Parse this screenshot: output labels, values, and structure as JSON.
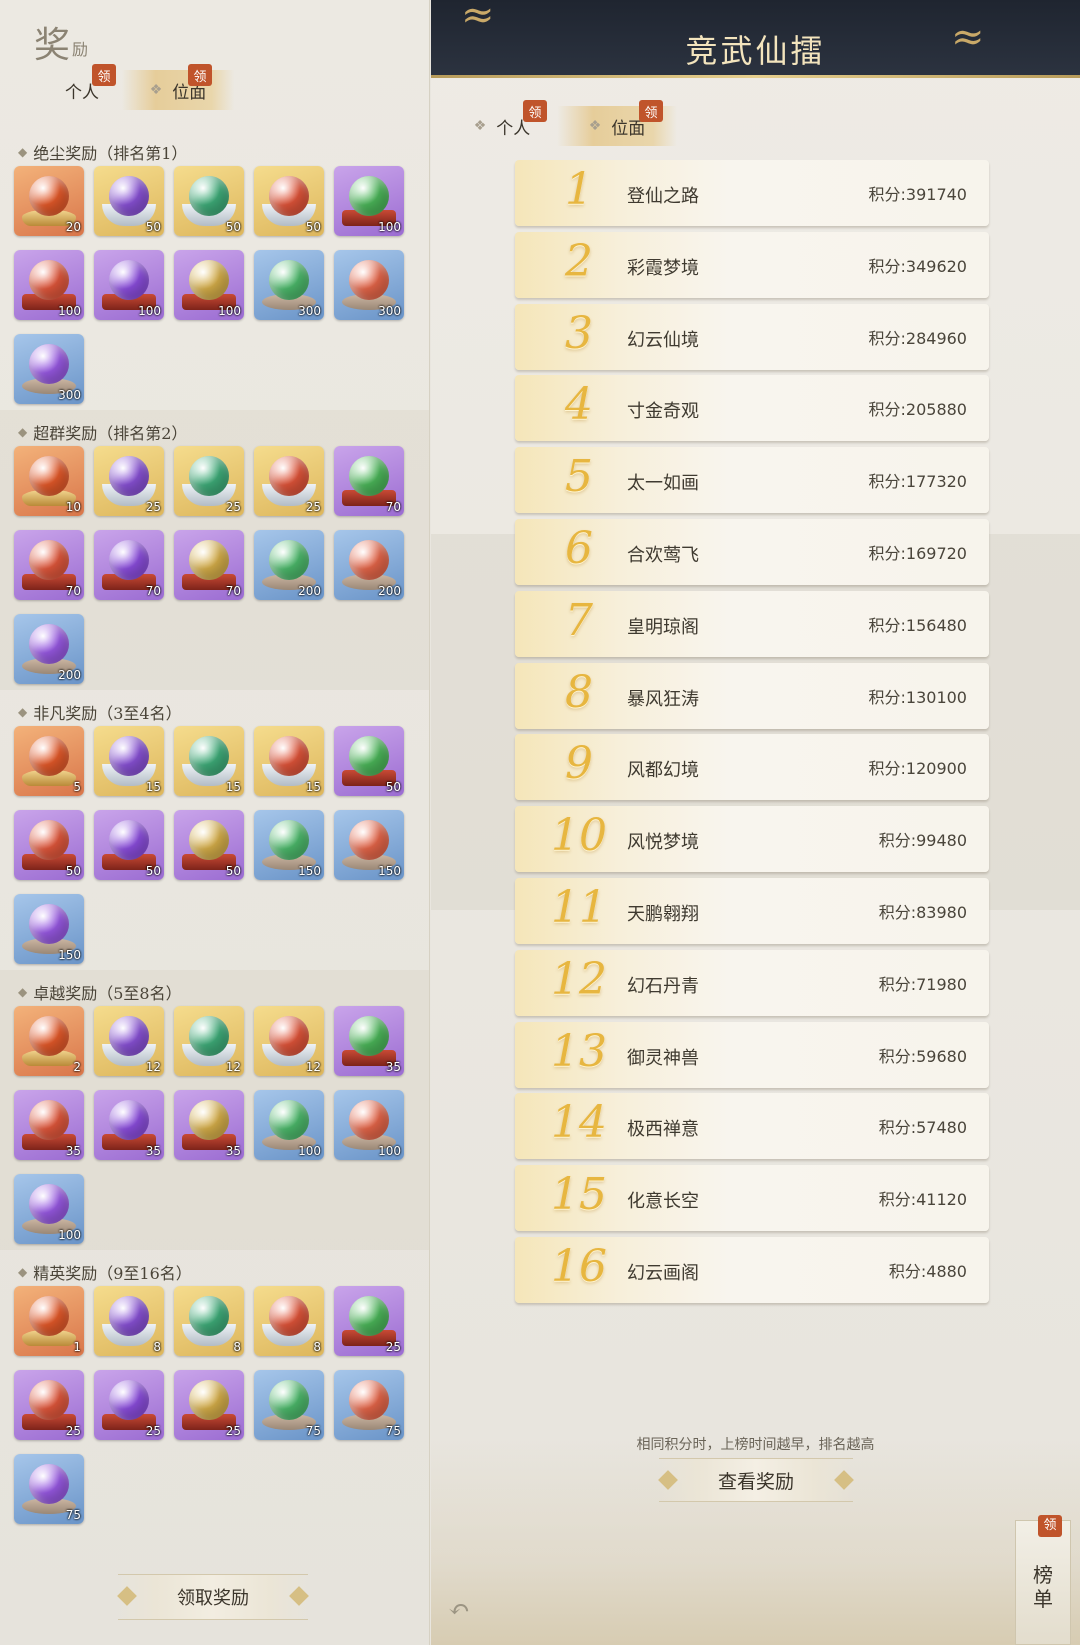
{
  "left_panel": {
    "title": "奖",
    "title_sub": "励",
    "tabs": [
      {
        "label": "个人",
        "badge": "领",
        "active": false
      },
      {
        "label": "位面",
        "badge": "领",
        "active": true
      }
    ],
    "sections": [
      {
        "title": "绝尘奖励（排名第1）",
        "items": [
          {
            "icon": "phoenix-orb-icon",
            "bg": "orange",
            "orb": "#e65a2a",
            "base": "lotus",
            "qty": "20"
          },
          {
            "icon": "purple-pill-bowl-icon",
            "bg": "gold",
            "orb": "#8a52d8",
            "base": "bowl",
            "qty": "50"
          },
          {
            "icon": "green-pill-bowl-icon",
            "bg": "gold",
            "orb": "#3fae7a",
            "base": "bowl",
            "qty": "50"
          },
          {
            "icon": "red-pill-bowl-icon",
            "bg": "gold",
            "orb": "#e2553a",
            "base": "bowl",
            "qty": "50"
          },
          {
            "icon": "green-orb-pedestal-icon",
            "bg": "purple",
            "orb": "#4cb85a",
            "base": "red",
            "qty": "100"
          },
          {
            "icon": "red-orb-pedestal-icon",
            "bg": "purple",
            "orb": "#e3583c",
            "base": "red",
            "qty": "100"
          },
          {
            "icon": "purple-orb-pedestal-icon",
            "bg": "purple",
            "orb": "#8d4ee0",
            "base": "red",
            "qty": "100"
          },
          {
            "icon": "gold-orb-pedestal-icon",
            "bg": "purple",
            "orb": "#d8b04a",
            "base": "red",
            "qty": "100"
          },
          {
            "icon": "green-orb-stone-icon",
            "bg": "blue",
            "orb": "#4dbb6c",
            "base": "stone",
            "qty": "300"
          },
          {
            "icon": "red-orb-stone-icon",
            "bg": "blue",
            "orb": "#e8674a",
            "base": "stone",
            "qty": "300"
          },
          {
            "icon": "purple-orb-stone-icon",
            "bg": "blue",
            "orb": "#9a5ae6",
            "base": "stone",
            "qty": "300"
          }
        ]
      },
      {
        "title": "超群奖励（排名第2）",
        "items": [
          {
            "icon": "phoenix-orb-icon",
            "bg": "orange",
            "orb": "#e65a2a",
            "base": "lotus",
            "qty": "10"
          },
          {
            "icon": "purple-pill-bowl-icon",
            "bg": "gold",
            "orb": "#8a52d8",
            "base": "bowl",
            "qty": "25"
          },
          {
            "icon": "green-pill-bowl-icon",
            "bg": "gold",
            "orb": "#3fae7a",
            "base": "bowl",
            "qty": "25"
          },
          {
            "icon": "red-pill-bowl-icon",
            "bg": "gold",
            "orb": "#e2553a",
            "base": "bowl",
            "qty": "25"
          },
          {
            "icon": "green-orb-pedestal-icon",
            "bg": "purple",
            "orb": "#4cb85a",
            "base": "red",
            "qty": "70"
          },
          {
            "icon": "red-orb-pedestal-icon",
            "bg": "purple",
            "orb": "#e3583c",
            "base": "red",
            "qty": "70"
          },
          {
            "icon": "purple-orb-pedestal-icon",
            "bg": "purple",
            "orb": "#8d4ee0",
            "base": "red",
            "qty": "70"
          },
          {
            "icon": "gold-orb-pedestal-icon",
            "bg": "purple",
            "orb": "#d8b04a",
            "base": "red",
            "qty": "70"
          },
          {
            "icon": "green-orb-stone-icon",
            "bg": "blue",
            "orb": "#4dbb6c",
            "base": "stone",
            "qty": "200"
          },
          {
            "icon": "red-orb-stone-icon",
            "bg": "blue",
            "orb": "#e8674a",
            "base": "stone",
            "qty": "200"
          },
          {
            "icon": "purple-orb-stone-icon",
            "bg": "blue",
            "orb": "#9a5ae6",
            "base": "stone",
            "qty": "200"
          }
        ]
      },
      {
        "title": "非凡奖励（3至4名）",
        "items": [
          {
            "icon": "phoenix-orb-icon",
            "bg": "orange",
            "orb": "#e65a2a",
            "base": "lotus",
            "qty": "5"
          },
          {
            "icon": "purple-pill-bowl-icon",
            "bg": "gold",
            "orb": "#8a52d8",
            "base": "bowl",
            "qty": "15"
          },
          {
            "icon": "green-pill-bowl-icon",
            "bg": "gold",
            "orb": "#3fae7a",
            "base": "bowl",
            "qty": "15"
          },
          {
            "icon": "red-pill-bowl-icon",
            "bg": "gold",
            "orb": "#e2553a",
            "base": "bowl",
            "qty": "15"
          },
          {
            "icon": "green-orb-pedestal-icon",
            "bg": "purple",
            "orb": "#4cb85a",
            "base": "red",
            "qty": "50"
          },
          {
            "icon": "red-orb-pedestal-icon",
            "bg": "purple",
            "orb": "#e3583c",
            "base": "red",
            "qty": "50"
          },
          {
            "icon": "purple-orb-pedestal-icon",
            "bg": "purple",
            "orb": "#8d4ee0",
            "base": "red",
            "qty": "50"
          },
          {
            "icon": "gold-orb-pedestal-icon",
            "bg": "purple",
            "orb": "#d8b04a",
            "base": "red",
            "qty": "50"
          },
          {
            "icon": "green-orb-stone-icon",
            "bg": "blue",
            "orb": "#4dbb6c",
            "base": "stone",
            "qty": "150"
          },
          {
            "icon": "red-orb-stone-icon",
            "bg": "blue",
            "orb": "#e8674a",
            "base": "stone",
            "qty": "150"
          },
          {
            "icon": "purple-orb-stone-icon",
            "bg": "blue",
            "orb": "#9a5ae6",
            "base": "stone",
            "qty": "150"
          }
        ]
      },
      {
        "title": "卓越奖励（5至8名）",
        "items": [
          {
            "icon": "phoenix-orb-icon",
            "bg": "orange",
            "orb": "#e65a2a",
            "base": "lotus",
            "qty": "2"
          },
          {
            "icon": "purple-pill-bowl-icon",
            "bg": "gold",
            "orb": "#8a52d8",
            "base": "bowl",
            "qty": "12"
          },
          {
            "icon": "green-pill-bowl-icon",
            "bg": "gold",
            "orb": "#3fae7a",
            "base": "bowl",
            "qty": "12"
          },
          {
            "icon": "red-pill-bowl-icon",
            "bg": "gold",
            "orb": "#e2553a",
            "base": "bowl",
            "qty": "12"
          },
          {
            "icon": "green-orb-pedestal-icon",
            "bg": "purple",
            "orb": "#4cb85a",
            "base": "red",
            "qty": "35"
          },
          {
            "icon": "red-orb-pedestal-icon",
            "bg": "purple",
            "orb": "#e3583c",
            "base": "red",
            "qty": "35"
          },
          {
            "icon": "purple-orb-pedestal-icon",
            "bg": "purple",
            "orb": "#8d4ee0",
            "base": "red",
            "qty": "35"
          },
          {
            "icon": "gold-orb-pedestal-icon",
            "bg": "purple",
            "orb": "#d8b04a",
            "base": "red",
            "qty": "35"
          },
          {
            "icon": "green-orb-stone-icon",
            "bg": "blue",
            "orb": "#4dbb6c",
            "base": "stone",
            "qty": "100"
          },
          {
            "icon": "red-orb-stone-icon",
            "bg": "blue",
            "orb": "#e8674a",
            "base": "stone",
            "qty": "100"
          },
          {
            "icon": "purple-orb-stone-icon",
            "bg": "blue",
            "orb": "#9a5ae6",
            "base": "stone",
            "qty": "100"
          }
        ]
      },
      {
        "title": "精英奖励（9至16名）",
        "items": [
          {
            "icon": "phoenix-orb-icon",
            "bg": "orange",
            "orb": "#e65a2a",
            "base": "lotus",
            "qty": "1"
          },
          {
            "icon": "purple-pill-bowl-icon",
            "bg": "gold",
            "orb": "#8a52d8",
            "base": "bowl",
            "qty": "8"
          },
          {
            "icon": "green-pill-bowl-icon",
            "bg": "gold",
            "orb": "#3fae7a",
            "base": "bowl",
            "qty": "8"
          },
          {
            "icon": "red-pill-bowl-icon",
            "bg": "gold",
            "orb": "#e2553a",
            "base": "bowl",
            "qty": "8"
          },
          {
            "icon": "green-orb-pedestal-icon",
            "bg": "purple",
            "orb": "#4cb85a",
            "base": "red",
            "qty": "25"
          },
          {
            "icon": "red-orb-pedestal-icon",
            "bg": "purple",
            "orb": "#e3583c",
            "base": "red",
            "qty": "25"
          },
          {
            "icon": "purple-orb-pedestal-icon",
            "bg": "purple",
            "orb": "#8d4ee0",
            "base": "red",
            "qty": "25"
          },
          {
            "icon": "gold-orb-pedestal-icon",
            "bg": "purple",
            "orb": "#d8b04a",
            "base": "red",
            "qty": "25"
          },
          {
            "icon": "green-orb-stone-icon",
            "bg": "blue",
            "orb": "#4dbb6c",
            "base": "stone",
            "qty": "75"
          },
          {
            "icon": "red-orb-stone-icon",
            "bg": "blue",
            "orb": "#e8674a",
            "base": "stone",
            "qty": "75"
          },
          {
            "icon": "purple-orb-stone-icon",
            "bg": "blue",
            "orb": "#9a5ae6",
            "base": "stone",
            "qty": "75"
          }
        ]
      }
    ],
    "claim_button": "领取奖励"
  },
  "right_panel": {
    "title": "竞武仙擂",
    "tabs": [
      {
        "label": "个人",
        "badge": "领",
        "active": false
      },
      {
        "label": "位面",
        "badge": "领",
        "active": true
      }
    ],
    "ranking": [
      {
        "rank": "1",
        "name": "登仙之路",
        "score": "积分:391740"
      },
      {
        "rank": "2",
        "name": "彩霞梦境",
        "score": "积分:349620"
      },
      {
        "rank": "3",
        "name": "幻云仙境",
        "score": "积分:284960"
      },
      {
        "rank": "4",
        "name": "寸金奇观",
        "score": "积分:205880"
      },
      {
        "rank": "5",
        "name": "太一如画",
        "score": "积分:177320"
      },
      {
        "rank": "6",
        "name": "合欢莺飞",
        "score": "积分:169720"
      },
      {
        "rank": "7",
        "name": "皇明琼阁",
        "score": "积分:156480"
      },
      {
        "rank": "8",
        "name": "暴风狂涛",
        "score": "积分:130100"
      },
      {
        "rank": "9",
        "name": "风都幻境",
        "score": "积分:120900"
      },
      {
        "rank": "10",
        "name": "风悦梦境",
        "score": "积分:99480"
      },
      {
        "rank": "11",
        "name": "天鹏翱翔",
        "score": "积分:83980"
      },
      {
        "rank": "12",
        "name": "幻石丹青",
        "score": "积分:71980"
      },
      {
        "rank": "13",
        "name": "御灵神兽",
        "score": "积分:59680"
      },
      {
        "rank": "14",
        "name": "极西禅意",
        "score": "积分:57480"
      },
      {
        "rank": "15",
        "name": "化意长空",
        "score": "积分:41120"
      },
      {
        "rank": "16",
        "name": "幻云画阁",
        "score": "积分:4880"
      }
    ],
    "note": "相同积分时，上榜时间越早，排名越高",
    "view_reward_button": "查看奖励",
    "side_tab": {
      "label_1": "榜",
      "label_2": "单",
      "badge": "领"
    },
    "back_icon": "↶"
  },
  "colors": {
    "accent_gold": "#e7b640",
    "badge_red": "#c0542b",
    "header_dark": "#1f2530"
  }
}
